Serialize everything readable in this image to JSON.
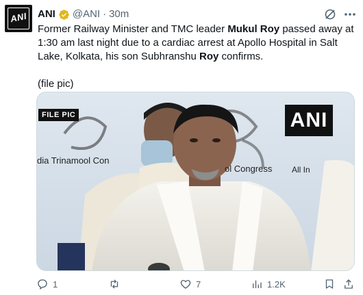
{
  "tweet": {
    "author_name": "ANI",
    "author_handle": "@ANI",
    "separator": "·",
    "time": "30m",
    "avatar_text": "ANI",
    "text_intro": "Former Railway Minister and TMC leader ",
    "text_name": "Mukul Roy",
    "text_mid": " passed away at 1:30 am last night due to a cardiac arrest at Apollo Hospital in Salt Lake, Kolkata, his son Subhranshu ",
    "text_surname": "Roy",
    "text_end": " confirms.",
    "file_pic_note": "(file pic)"
  },
  "media": {
    "tag": "FILE PIC",
    "watermark": "ANI",
    "banner_left": "dia Trinamool Con",
    "banner_mid": "ol Congress",
    "banner_right": "All In"
  },
  "actions": {
    "reply_count": "1",
    "repost_count": "",
    "like_count": "7",
    "views_count": "1.2K"
  },
  "colors": {
    "text": "#0f1419",
    "muted": "#536471",
    "verified": "#e2b719"
  },
  "icons": [
    "verified-badge-icon",
    "grok-icon",
    "more-icon",
    "reply-icon",
    "repost-icon",
    "like-icon",
    "views-icon",
    "bookmark-icon",
    "share-icon"
  ]
}
